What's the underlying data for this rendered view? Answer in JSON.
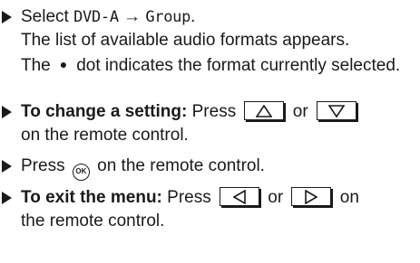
{
  "steps": [
    {
      "pre": "Select ",
      "screen1": "DVD-A",
      "arrow": " → ",
      "screen2": "Group",
      "post": ".",
      "line2": "The list of available audio formats appears.",
      "line3a": "The",
      "dot": "●",
      "line3b": "dot indicates the format currently selected."
    },
    {
      "bold": "To change a setting:",
      "pre": " Press ",
      "key1": "up-triangle-icon",
      "mid": " or ",
      "key2": "down-triangle-icon",
      "post": "on the remote control."
    },
    {
      "pre": "Press ",
      "ok": "OK",
      "post": " on the remote control."
    },
    {
      "bold": "To exit the menu:",
      "pre": " Press ",
      "key1": "left-triangle-icon",
      "mid": " or ",
      "key2": "right-triangle-icon",
      "post1": " on",
      "post2": "the remote control."
    }
  ]
}
